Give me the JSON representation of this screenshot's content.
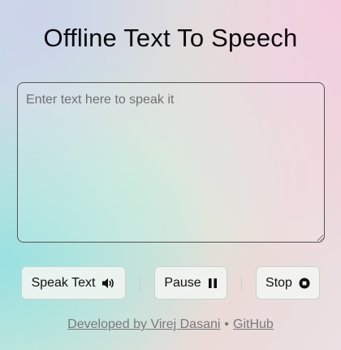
{
  "header": {
    "title": "Offline Text To Speech"
  },
  "editor": {
    "placeholder": "Enter text here to speak it",
    "value": ""
  },
  "controls": {
    "speak_label": "Speak Text",
    "speak_icon": "speaker-volume-icon",
    "pause_label": "Pause",
    "pause_icon": "pause-icon",
    "stop_label": "Stop",
    "stop_icon": "stop-circle-icon"
  },
  "footer": {
    "credit_label": "Developed by Virej Dasani",
    "separator": "•",
    "github_label": "GitHub"
  }
}
